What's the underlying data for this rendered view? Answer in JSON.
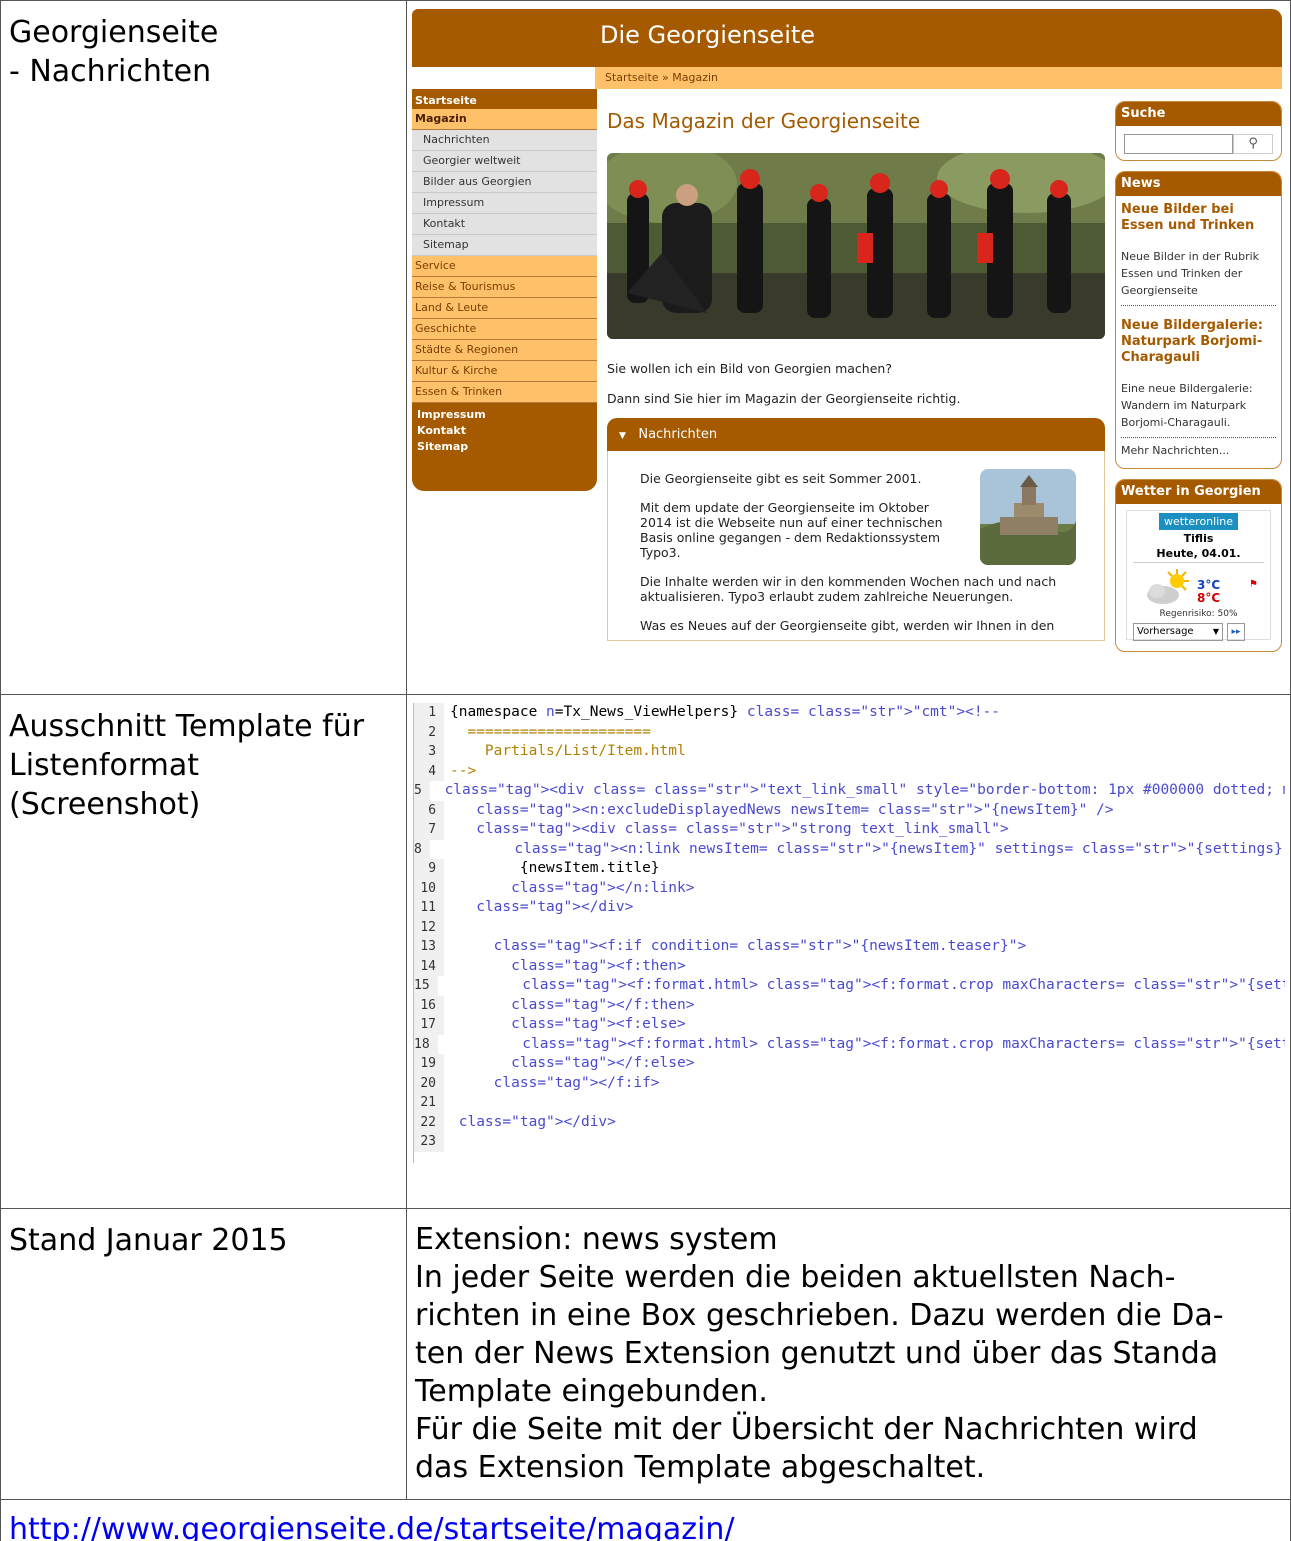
{
  "doc": {
    "row1_label": [
      "Georgienseite",
      "- Nachrichten"
    ],
    "row2_label": [
      "Ausschnitt Template für",
      "Listenformat",
      "(Screenshot)"
    ],
    "row3_label": "Stand Januar 2015",
    "row3_text": [
      "Extension: news system",
      "In jeder Seite werden die beiden aktuellsten Nach-",
      "richten in eine Box geschrieben. Dazu werden die Da-",
      "ten der News Extension genutzt und über das Standa",
      "Template eingebunden.",
      "Für die Seite mit der Übersicht der Nachrichten wird",
      "das Extension Template abgeschaltet."
    ],
    "link": "http://www.georgienseite.de/startseite/magazin/"
  },
  "site": {
    "title": "Die Georgienseite",
    "breadcrumb": "Startseite » Magazin",
    "nav_top": "Startseite",
    "nav_active": "Magazin",
    "nav_sub": [
      "Nachrichten",
      "Georgier weltweit",
      "Bilder aus Georgien",
      "Impressum",
      "Kontakt",
      "Sitemap"
    ],
    "nav_main": [
      "Service",
      "Reise & Tourismus",
      "Land & Leute",
      "Geschichte",
      "Städte & Regionen",
      "Kultur & Kirche",
      "Essen & Trinken"
    ],
    "nav_bottom": [
      "Impressum",
      "Kontakt",
      "Sitemap"
    ],
    "main_heading": "Das Magazin der Georgienseite",
    "main_p1": "Sie wollen ich ein Bild von Georgien machen?",
    "main_p2": "Dann sind Sie hier im Magazin der Georgienseite richtig.",
    "accordion_title": "Nachrichten",
    "acc_p1": "Die Georgienseite gibt es seit Sommer 2001.",
    "acc_p2": "Mit dem update der Georgienseite im Oktober 2014 ist die Webseite nun auf einer technischen Basis online gegangen - dem Redaktionssystem Typo3.",
    "acc_p3": "Die Inhalte werden wir in den kommenden Wochen nach und nach aktualisieren. Typo3 erlaubt zudem zahlreiche Neuerungen.",
    "acc_p4": "Was es Neues auf der Georgienseite gibt, werden wir Ihnen in den",
    "search_title": "Suche",
    "news_title": "News",
    "news": [
      {
        "title": "Neue Bilder bei Essen und Trinken",
        "text": "Neue Bilder in der Rubrik Essen und Trinken der Georgienseite"
      },
      {
        "title": "Neue Bildergalerie: Naturpark Borjomi-Charagauli",
        "text": "Eine neue Bildergalerie: Wandern im Naturpark Borjomi-Charagauli."
      }
    ],
    "news_more": "Mehr Nachrichten...",
    "weather_title": "Wetter in Georgien",
    "weather_logo": "wetteronline",
    "weather_city": "Tiflis",
    "weather_date": "Heute, 04.01.",
    "weather_max": "3°C",
    "weather_min": "8°C",
    "weather_rain": "Regenrisiko: 50%",
    "weather_select": "Vorhersage",
    "search_icon": "magnifier-icon"
  },
  "code_lines": [
    "{namespace n=Tx_News_ViewHelpers}<!--",
    "  =====================",
    "    Partials/List/Item.html",
    "-->",
    "<div class=\"text_link_small\" style=\"border-bottom: 1px #000000 dotted; margin-botto",
    "  <n:excludeDisplayedNews newsItem=\"{newsItem}\" />",
    "  <div class=\"strong text_link_small\">",
    "        <n:link newsItem=\"{newsItem}\" settings=\"{settings}\">",
    "        {newsItem.title}",
    "      </n:link>",
    "  </div>",
    "",
    "    <f:if condition=\"{newsItem.teaser}\">",
    "      <f:then>",
    "        <f:format.html><f:format.crop maxCharacters=\"{settings.cropMaxCharacters}\"",
    "      </f:then>",
    "      <f:else>",
    "        <f:format.html><f:format.crop maxCharacters=\"{settings.cropMaxCharacters}\"",
    "      </f:else>",
    "    </f:if>",
    "",
    "</div>",
    ""
  ],
  "colors": {
    "brand": "#a55a00",
    "nav_light": "#ffc06a",
    "link": "#0000ee"
  }
}
